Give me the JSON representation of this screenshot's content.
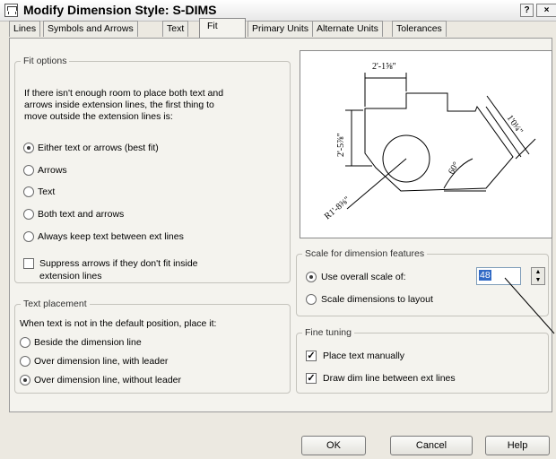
{
  "window": {
    "title": "Modify Dimension Style: S-DIMS",
    "help_btn": "?",
    "close_btn": "×"
  },
  "tabs": [
    "Lines",
    "Symbols and Arrows",
    "Text",
    "Fit",
    "Primary Units",
    "Alternate Units",
    "Tolerances"
  ],
  "active_tab": "Fit",
  "fit_options": {
    "legend": "Fit options",
    "description": [
      "If there isn't enough room to place both text and",
      "arrows inside extension lines, the first thing to",
      "move outside the extension lines is:"
    ],
    "options": [
      {
        "label": "Either text or arrows (best fit)",
        "selected": true
      },
      {
        "label": "Arrows",
        "selected": false
      },
      {
        "label": "Text",
        "selected": false
      },
      {
        "label": "Both text and arrows",
        "selected": false
      },
      {
        "label": "Always keep text between ext lines",
        "selected": false
      }
    ],
    "suppress_line1": "Suppress arrows if they don't fit inside",
    "suppress_line2": "extension lines",
    "suppress_checked": false
  },
  "text_placement": {
    "legend": "Text placement",
    "description": "When text is not in the default position, place it:",
    "options": [
      {
        "label": "Beside the dimension line",
        "selected": false
      },
      {
        "label": "Over dimension line, with leader",
        "selected": false
      },
      {
        "label": "Over dimension line, without leader",
        "selected": true
      }
    ]
  },
  "preview": {
    "dim_top": "2'-1⅝\"",
    "dim_left": "2'-5⅞\"",
    "dim_right": "1'0¼\"",
    "dim_angle": "60°",
    "dim_radius": "R1'-8⅜\""
  },
  "scale": {
    "legend": "Scale for dimension features",
    "use_overall": "Use overall scale of:",
    "use_overall_selected": true,
    "scale_value": "48",
    "scale_to_layout": "Scale dimensions to layout",
    "scale_to_layout_selected": false
  },
  "fine_tuning": {
    "legend": "Fine tuning",
    "place_manual": "Place text manually",
    "place_manual_checked": true,
    "draw_dim": "Draw dim line between ext lines",
    "draw_dim_checked": true
  },
  "buttons": {
    "ok": "OK",
    "cancel": "Cancel",
    "help": "Help"
  }
}
